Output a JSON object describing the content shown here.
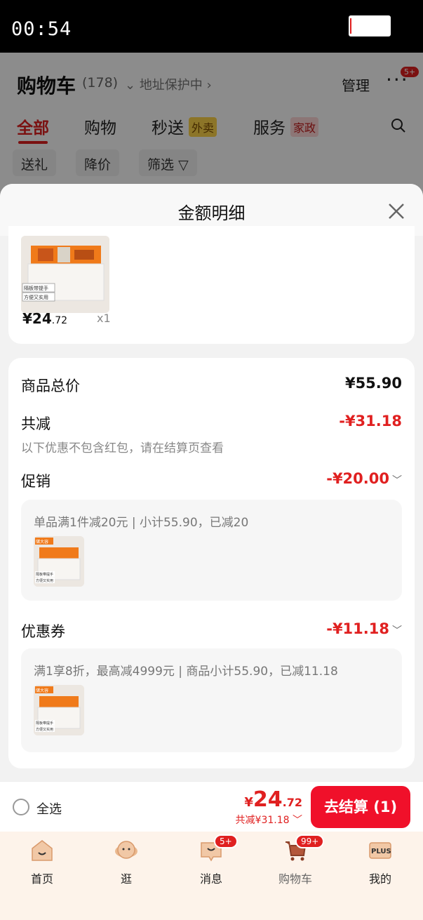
{
  "status_bar": {
    "time": "00:54"
  },
  "header": {
    "title": "购物车",
    "count": "(178)",
    "address_protect": "地址保护中",
    "manage": "管理",
    "more_badge": "5+"
  },
  "tabs": [
    {
      "label": "全部",
      "active": true
    },
    {
      "label": "购物"
    },
    {
      "label": "秒送",
      "tag": "外卖"
    },
    {
      "label": "服务",
      "tag": "家政"
    }
  ],
  "filters": [
    "送礼",
    "降价",
    "筛选"
  ],
  "sheet": {
    "title": "金额明细",
    "item": {
      "caption1": "隔板带提手",
      "caption2": "方便又实用",
      "price_main": "¥24",
      "price_dec": ".72",
      "qty": "x1"
    },
    "goods_total_label": "商品总价",
    "goods_total_value": "¥55.90",
    "discount_label": "共减",
    "discount_value": "-¥31.18",
    "discount_note": "以下优惠不包含红包，请在结算页查看",
    "promo_label": "促销",
    "promo_value": "-¥20.00",
    "promo_detail": "单品满1件减20元 | 小计55.90，已减20",
    "coupon_label": "优惠券",
    "coupon_value": "-¥11.18",
    "coupon_detail": "满1享8折，最高减4999元 | 商品小计55.90，已减11.18",
    "thumb_tag": "储大容",
    "thumb_caption1": "隔板带提手",
    "thumb_caption2": "方便又实用"
  },
  "checkout": {
    "select_all": "全选",
    "total_yen": "¥",
    "total_int": "24",
    "total_dec": ".72",
    "saved": "共减¥31.18",
    "button": "去结算 (1)"
  },
  "bottom_nav": [
    {
      "label": "首页",
      "icon": "home-icon"
    },
    {
      "label": "逛",
      "icon": "explore-icon"
    },
    {
      "label": "消息",
      "icon": "message-icon",
      "badge": "5+"
    },
    {
      "label": "购物车",
      "icon": "cart-icon",
      "badge": "99+"
    },
    {
      "label": "我的",
      "icon": "plus-icon",
      "badge_text": "PLUS"
    }
  ],
  "colors": {
    "accent": "#e02020",
    "button": "#f0102a"
  }
}
